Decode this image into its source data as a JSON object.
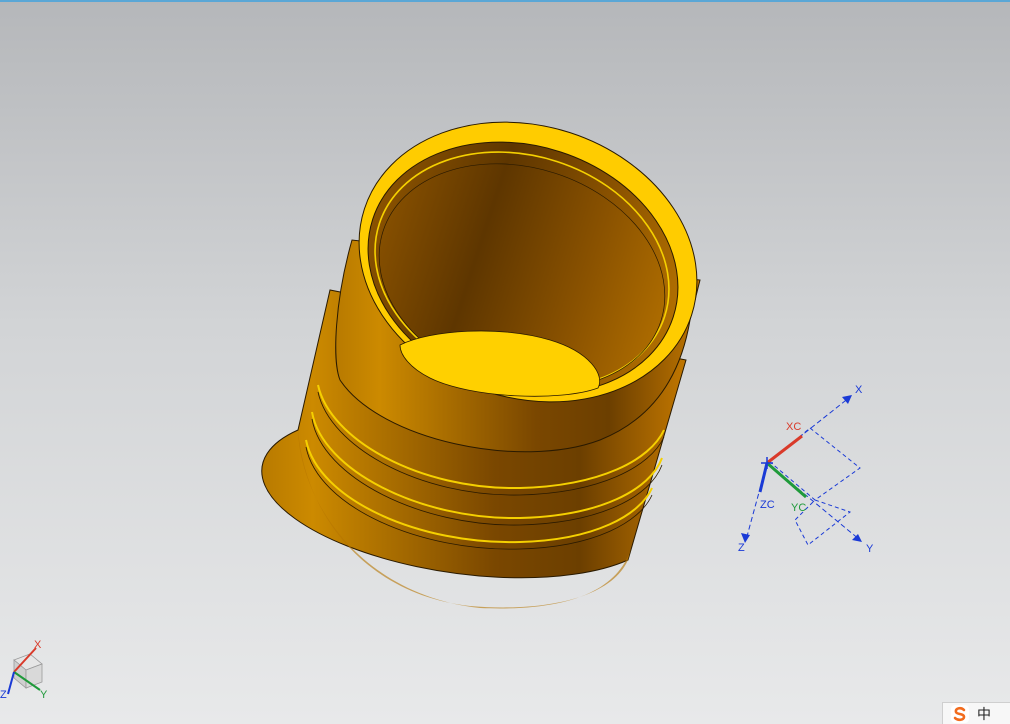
{
  "viewport": {
    "background_top": "#b5b7ba",
    "background_bottom": "#e8e9ea",
    "part_color": "#ffcc00",
    "part_shadow": "#6b3f00"
  },
  "wcs_triad": {
    "x_label": "X",
    "y_label": "Y",
    "z_label": "Z",
    "xc_label": "XC",
    "yc_label": "YC",
    "zc_label": "ZC"
  },
  "view_triad": {
    "x_label": "X",
    "y_label": "Y",
    "z_label": "Z"
  },
  "ime": {
    "logo_icon": "sogou-logo-icon",
    "mode_label": "中"
  }
}
